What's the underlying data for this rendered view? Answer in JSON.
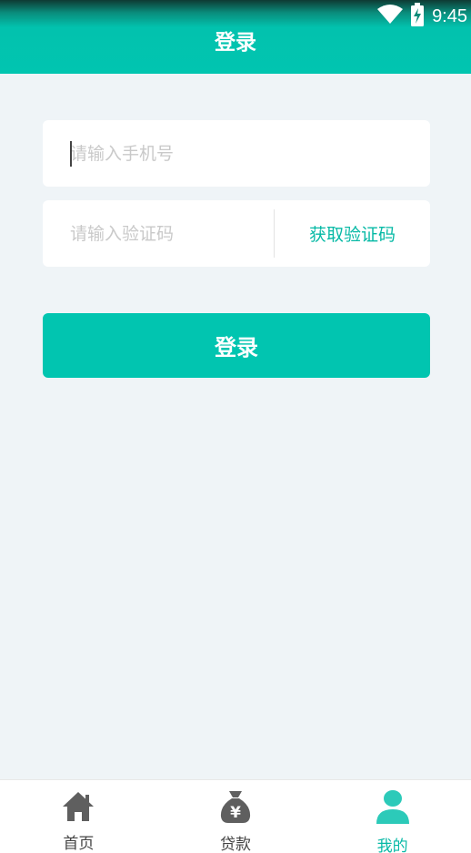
{
  "status_bar": {
    "time": "9:45"
  },
  "header": {
    "title": "登录"
  },
  "form": {
    "phone_placeholder": "请输入手机号",
    "phone_value": "",
    "code_placeholder": "请输入验证码",
    "code_value": "",
    "get_code_label": "获取验证码",
    "login_label": "登录"
  },
  "bottom_nav": {
    "items": [
      {
        "label": "首页",
        "icon": "home-icon",
        "active": false
      },
      {
        "label": "贷款",
        "icon": "money-bag-icon",
        "active": false
      },
      {
        "label": "我的",
        "icon": "user-icon",
        "active": true
      }
    ]
  },
  "colors": {
    "accent": "#01c5b0",
    "background": "#eff4f7",
    "nav_inactive": "#5f5f5f",
    "nav_active": "#2ccab9"
  }
}
